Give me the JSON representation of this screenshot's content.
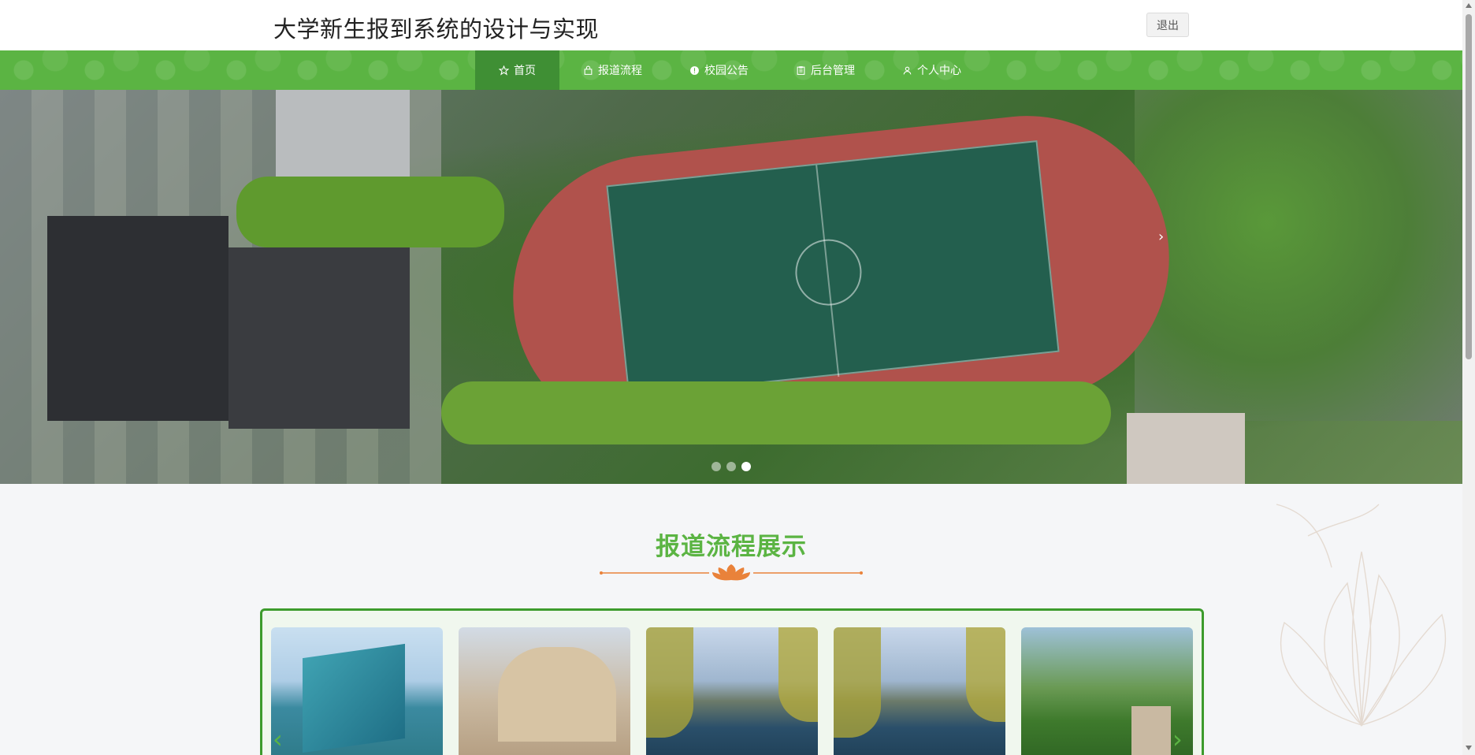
{
  "header": {
    "title": "大学新生报到系统的设计与实现",
    "logout_label": "退出"
  },
  "nav": {
    "items": [
      {
        "label": "首页",
        "icon": "star-icon",
        "active": true
      },
      {
        "label": "报道流程",
        "icon": "bag-icon",
        "active": false
      },
      {
        "label": "校园公告",
        "icon": "info-circle-icon",
        "active": false
      },
      {
        "label": "后台管理",
        "icon": "clipboard-icon",
        "active": false
      },
      {
        "label": "个人中心",
        "icon": "user-icon",
        "active": false
      }
    ]
  },
  "carousel": {
    "arrow_label": "›",
    "slide_count": 3,
    "active_index": 2
  },
  "section": {
    "title": "报道流程展示",
    "prev_arrow": "‹",
    "next_arrow": "›"
  },
  "colors": {
    "brand_green": "#5bb443",
    "nav_active": "#3f8f34",
    "frame_border": "#3d9b2d",
    "deco_orange": "#e9823a"
  }
}
